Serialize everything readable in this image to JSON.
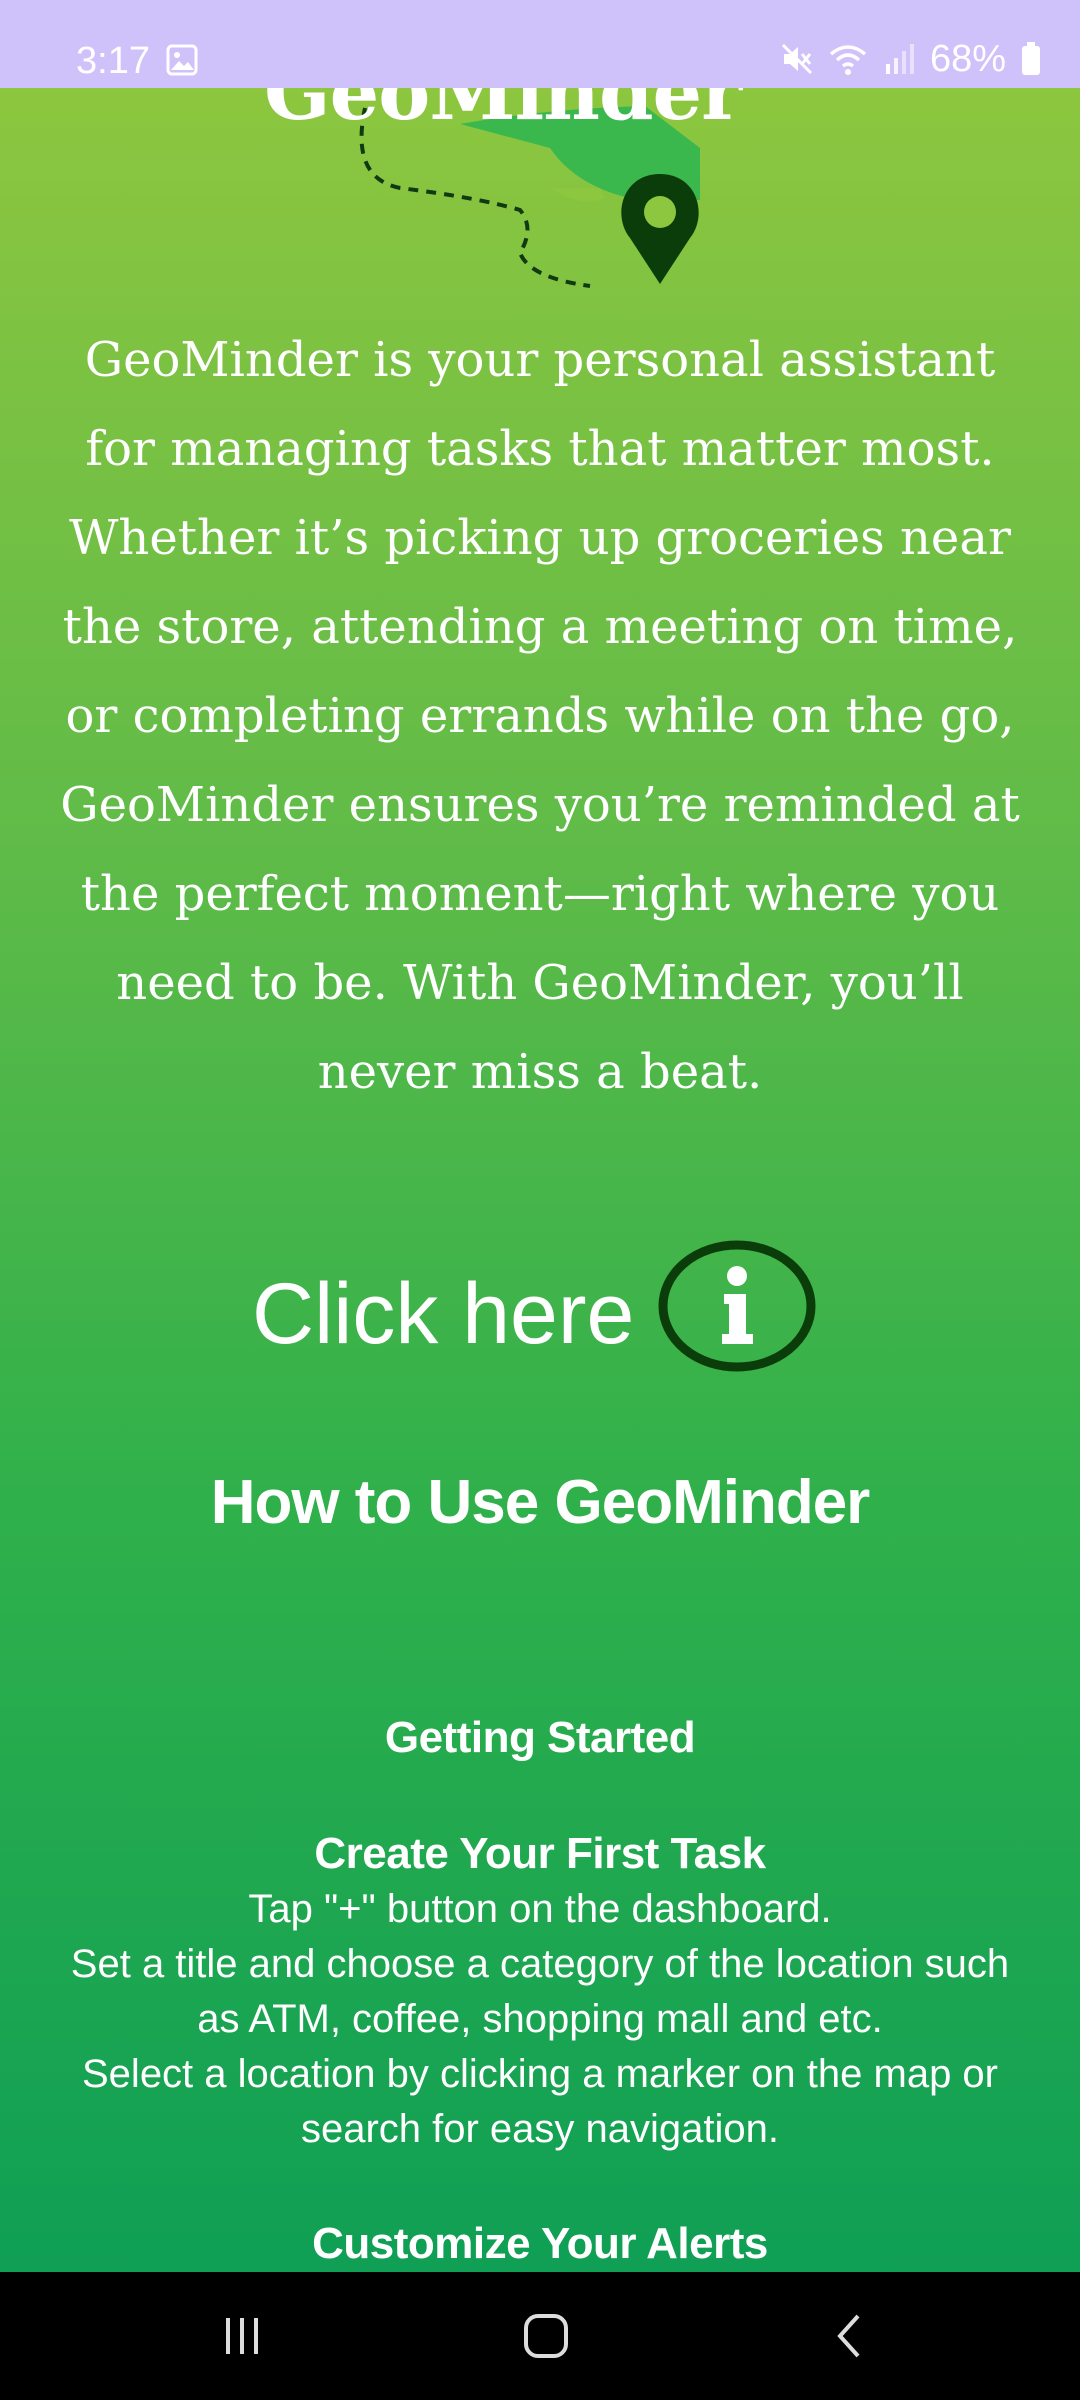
{
  "status_bar": {
    "time": "3:17",
    "battery": "68%",
    "icons": [
      "image-icon",
      "mute-icon",
      "wifi-icon",
      "signal-icon",
      "battery-icon"
    ]
  },
  "logo": {
    "text": "GeoMinder",
    "icon": "map-pin-icon"
  },
  "intro": "GeoMinder is your personal assistant for managing tasks that matter most. Whether it’s picking up groceries near the store, attending a meeting on time, or completing errands while on the go, GeoMinder ensures you’re reminded at the perfect moment—right where you need to be. With GeoMinder, you’ll never miss a beat.",
  "click_here": {
    "label": "Click here",
    "icon": "info-icon"
  },
  "how_to": {
    "title": "How to Use GeoMinder",
    "getting_started": "Getting Started",
    "first_task": {
      "title": "Create Your First Task",
      "steps": [
        "Tap \"+\" button on the dashboard.",
        "Set a title and choose a category of the location such as ATM, coffee, shopping mall and etc.",
        "Select a location by clicking a marker on the map or search for easy navigation."
      ]
    },
    "customize": "Customize Your Alerts"
  },
  "nav": {
    "icons": [
      "recent-apps-icon",
      "home-icon",
      "back-icon"
    ]
  },
  "colors": {
    "status_bar": "#cfc2fb",
    "gradient_top": "#8dc63f",
    "gradient_bottom": "#0f9f55",
    "pin": "#0b3d0b",
    "text": "#ffffff"
  }
}
